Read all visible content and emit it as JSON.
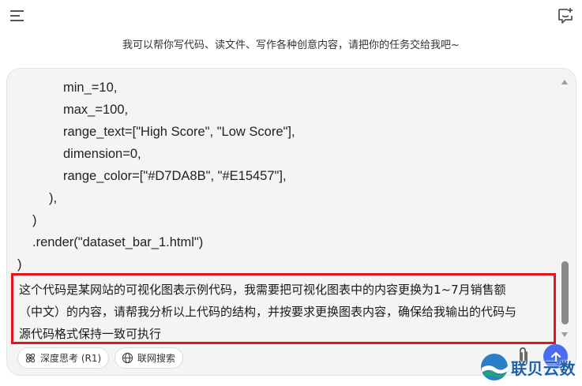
{
  "header": {
    "menu_icon": "hamburger-menu-icon",
    "new_chat_icon": "new-chat-icon",
    "tagline": "我可以帮你写代码、读文件、写作各种创意内容，请把你的任务交给我吧~"
  },
  "composer": {
    "code_lines": [
      "min_=10,",
      "max_=100,",
      "range_text=[\"High Score\", \"Low Score\"],",
      "dimension=0,",
      "range_color=[\"#D7DA8B\", \"#E15457\"],",
      "),",
      ")",
      ".render(\"dataset_bar_1.html\")",
      ")"
    ],
    "prompt_lines": [
      "这个代码是某网站的可视化图表示例代码，我需要把可视化图表中的内容更换为1~7月销售额",
      "（中文）的内容，请帮我分析以上代码的结构，并按要求更换图表内容，确保给我输出的代码与",
      "源代码格式保持一致可执行"
    ],
    "highlight_color": "#E5161B",
    "chips": {
      "deep_think": "深度思考 (R1)",
      "web_search": "联网搜索"
    },
    "attach_icon": "paperclip-icon",
    "send_icon": "arrow-up-icon",
    "send_color": "#4B6CF0"
  },
  "watermark": {
    "text": "联贝云数"
  }
}
